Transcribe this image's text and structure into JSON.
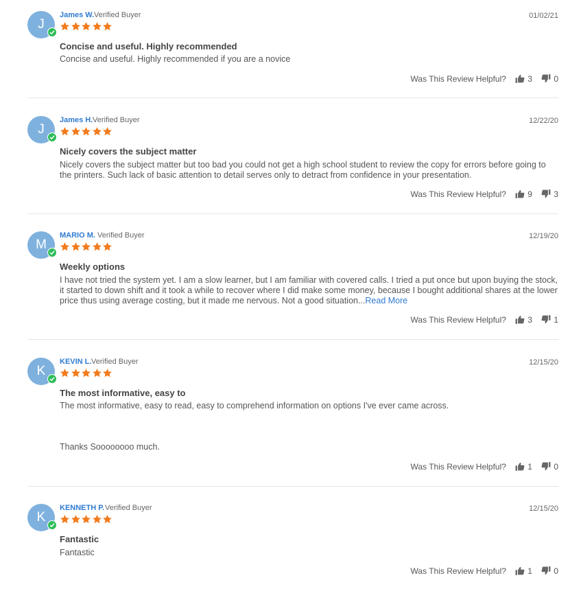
{
  "colors": {
    "accent": "#2f7bd0",
    "star": "#f17b1d",
    "avatar": "#7fb1de",
    "verified": "#2ebd59"
  },
  "icons": {
    "star": "star-icon",
    "up": "thumbs-up-icon",
    "down": "thumbs-down-icon",
    "check": "checkmark-icon"
  },
  "helpful_label": "Was This Review Helpful?",
  "reviews": [
    {
      "initial": "J",
      "name": "James W.",
      "verified": "Verified Buyer",
      "date": "01/02/21",
      "rating": 5,
      "title": "Concise and useful. Highly recommended",
      "body": "Concise and useful. Highly recommended if you are a novice",
      "up": "3",
      "down": "0"
    },
    {
      "initial": "J",
      "name": "James H.",
      "verified": "Verified Buyer",
      "date": "12/22/20",
      "rating": 5,
      "title": "Nicely covers the subject matter",
      "body": "Nicely covers the subject matter but too bad you could not get a high school student to review the copy for errors before going to the printers. Such lack of basic attention to detail serves only to detract from confidence in your presentation.",
      "up": "9",
      "down": "3"
    },
    {
      "initial": "M",
      "name": "MARIO M.",
      "verified": "Verified Buyer",
      "date": "12/19/20",
      "rating": 5,
      "title": "Weekly options",
      "body": "I have not tried the system yet. I am a slow learner, but I am familiar with covered calls. I tried a put once but upon buying the stock, it started to down shift and it took a while to recover where I did make some money, because I bought additional shares at the lower price thus using average costing, but it made me nervous. Not a good situation...",
      "read_more": "Read More",
      "up": "3",
      "down": "1"
    },
    {
      "initial": "K",
      "name": "KEVIN L.",
      "verified": "Verified Buyer",
      "date": "12/15/20",
      "rating": 5,
      "title": "The most informative, easy to",
      "body": "The most informative, easy to read, easy to comprehend information on options I've ever came across.",
      "body2": "Thanks Soooooooo much.",
      "up": "1",
      "down": "0"
    },
    {
      "initial": "K",
      "name": "KENNETH P.",
      "verified": "Verified Buyer",
      "date": "12/15/20",
      "rating": 5,
      "title": "Fantastic",
      "body": "Fantastic",
      "up": "1",
      "down": "0"
    }
  ]
}
